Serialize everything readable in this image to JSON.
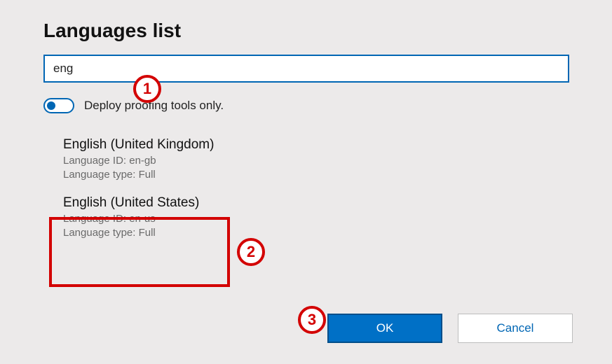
{
  "title": "Languages list",
  "search": {
    "value": "eng"
  },
  "toggle": {
    "label": "Deploy proofing tools only."
  },
  "results": [
    {
      "name": "English (United Kingdom)",
      "id_label": "Language ID: en-gb",
      "type_label": "Language type: Full"
    },
    {
      "name": "English (United States)",
      "id_label": "Language ID: en-us",
      "type_label": "Language type: Full"
    }
  ],
  "buttons": {
    "ok": "OK",
    "cancel": "Cancel"
  },
  "annotations": {
    "one": "1",
    "two": "2",
    "three": "3"
  }
}
